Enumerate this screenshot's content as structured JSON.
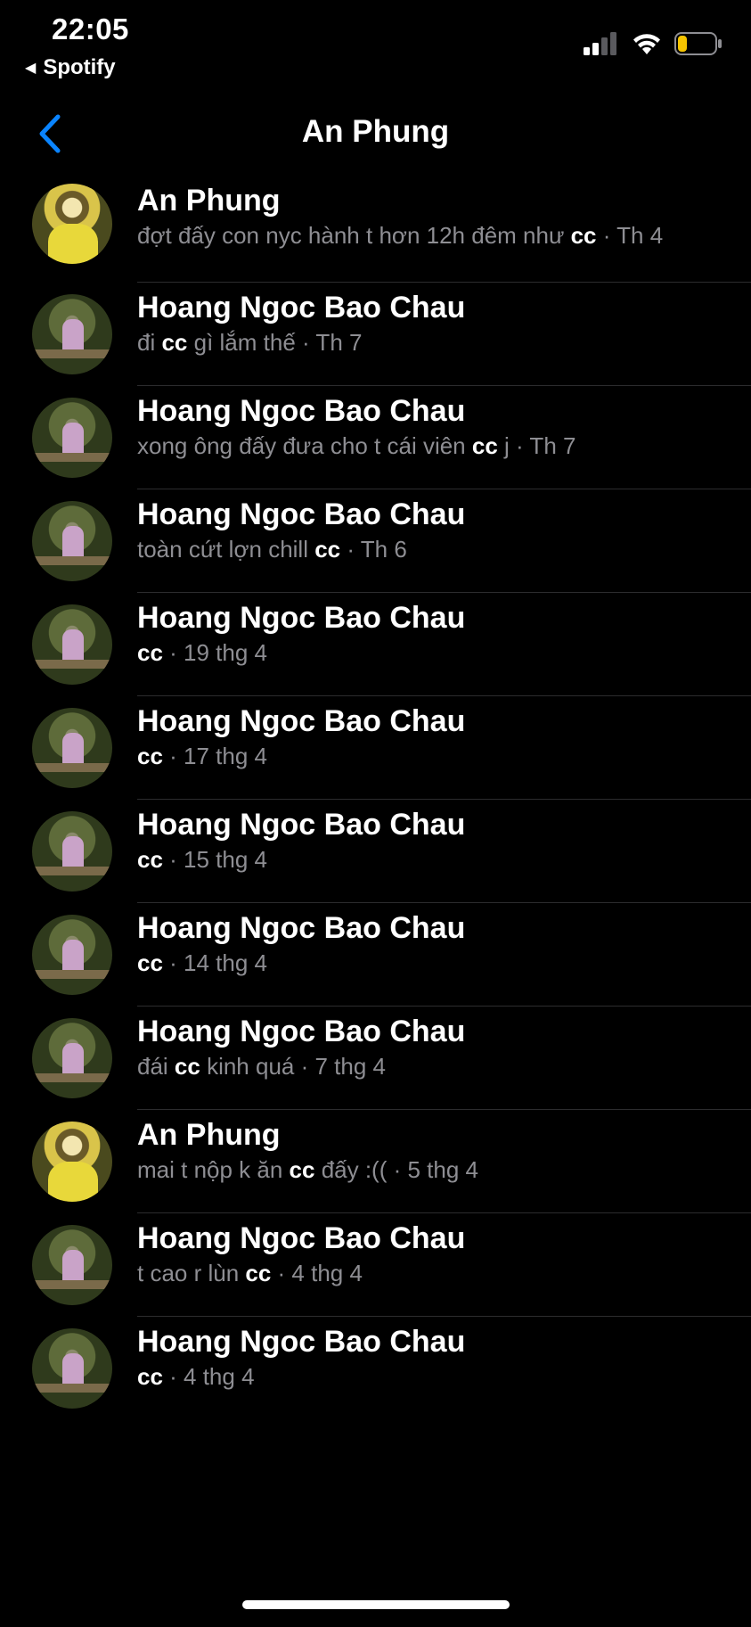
{
  "status_bar": {
    "time": "22:05",
    "back_app": "Spotify",
    "signal_icon": "cellular-signal-icon",
    "wifi_icon": "wifi-icon",
    "battery_icon": "battery-low-icon",
    "battery_color": "#f5c400"
  },
  "nav": {
    "back_icon": "chevron-left-icon",
    "back_color": "#0a84ff",
    "title": "An Phung"
  },
  "results": [
    {
      "name": "An Phung",
      "avatar": "an",
      "pre": "đợt đấy con nyc hành t hơn 12h đêm như ",
      "hl": "cc",
      "post": "",
      "time": " · Th 4"
    },
    {
      "name": "Hoang Ngoc Bao Chau",
      "avatar": "bc",
      "pre": "đi ",
      "hl": "cc",
      "post": " gì lắm thế",
      "time": " · Th 7"
    },
    {
      "name": "Hoang Ngoc Bao Chau",
      "avatar": "bc",
      "pre": "xong ông đấy đưa cho t cái viên ",
      "hl": "cc",
      "post": " j",
      "time": " · Th 7"
    },
    {
      "name": "Hoang Ngoc Bao Chau",
      "avatar": "bc",
      "pre": "toàn cứt lợn chill ",
      "hl": "cc",
      "post": "",
      "time": " · Th 6"
    },
    {
      "name": "Hoang Ngoc Bao Chau",
      "avatar": "bc",
      "pre": "",
      "hl": "cc",
      "post": "",
      "time": " · 19 thg 4"
    },
    {
      "name": "Hoang Ngoc Bao Chau",
      "avatar": "bc",
      "pre": "",
      "hl": "cc",
      "post": "",
      "time": " · 17 thg 4"
    },
    {
      "name": "Hoang Ngoc Bao Chau",
      "avatar": "bc",
      "pre": "",
      "hl": "cc",
      "post": "",
      "time": " · 15 thg 4"
    },
    {
      "name": "Hoang Ngoc Bao Chau",
      "avatar": "bc",
      "pre": "",
      "hl": "cc",
      "post": "",
      "time": " · 14 thg 4"
    },
    {
      "name": "Hoang Ngoc Bao Chau",
      "avatar": "bc",
      "pre": "đái ",
      "hl": "cc",
      "post": " kinh quá",
      "time": " · 7 thg 4"
    },
    {
      "name": "An Phung",
      "avatar": "an",
      "pre": "mai t nộp k ăn ",
      "hl": "cc",
      "post": " đấy :((",
      "time": " · 5 thg 4"
    },
    {
      "name": "Hoang Ngoc Bao Chau",
      "avatar": "bc",
      "pre": "t cao r lùn ",
      "hl": "cc",
      "post": "",
      "time": " · 4 thg 4"
    },
    {
      "name": "Hoang Ngoc Bao Chau",
      "avatar": "bc",
      "pre": "",
      "hl": "cc",
      "post": "",
      "time": " · 4 thg 4"
    }
  ]
}
